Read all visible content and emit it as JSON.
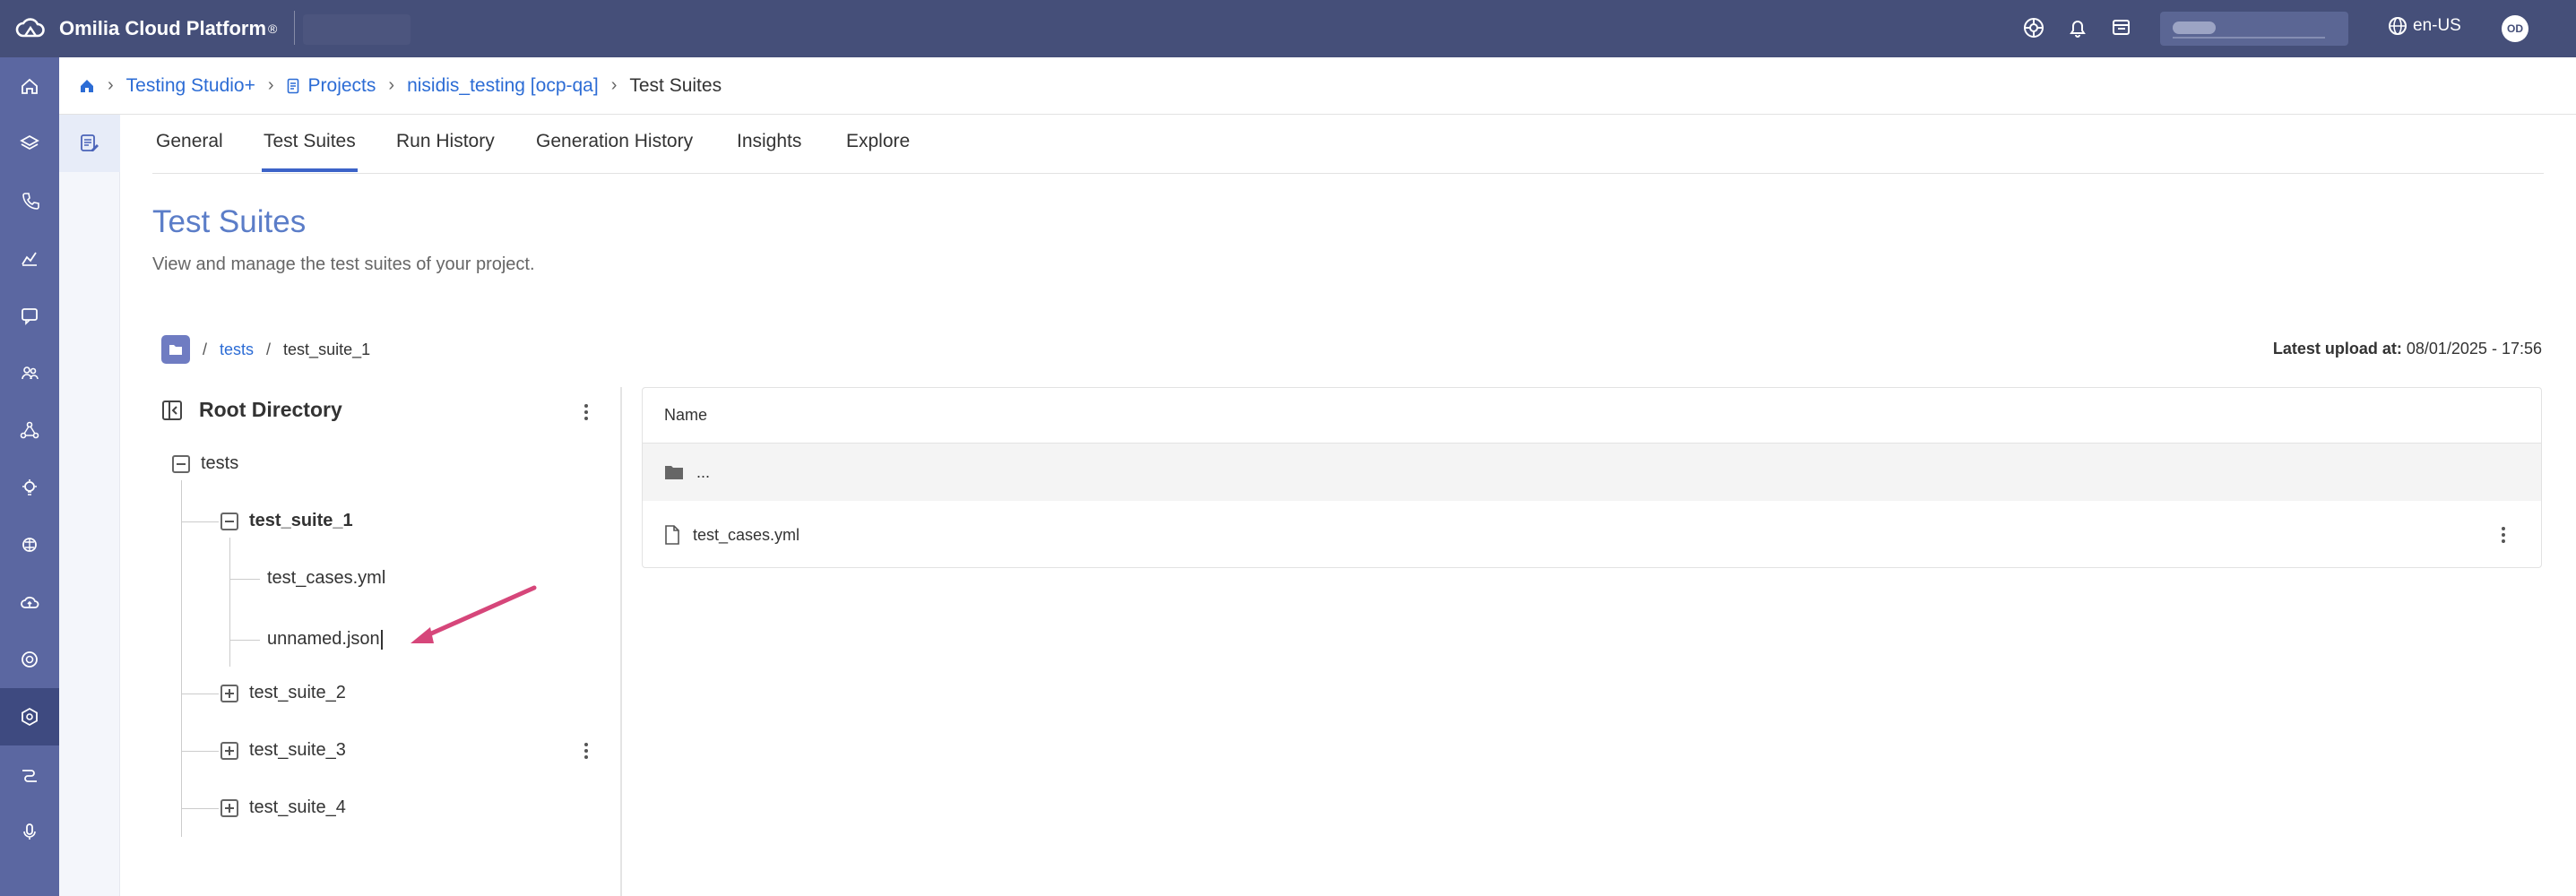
{
  "app": {
    "title": "Omilia Cloud Platform",
    "trademark": "®"
  },
  "topbar": {
    "icons": [
      "help-wheel-icon",
      "bell-icon",
      "notes-icon"
    ],
    "language": "en-US",
    "avatar_initials": "OD"
  },
  "leftnav": {
    "items": [
      "home-icon",
      "layers-icon",
      "phone-icon",
      "analytics-icon",
      "chat-icon",
      "users-icon",
      "network-icon",
      "bulb-icon",
      "brain-icon",
      "cloud-upload-icon",
      "support-icon",
      "settings-hex-icon",
      "flows-icon",
      "voice-icon"
    ],
    "active_index": 11
  },
  "breadcrumb": {
    "items": [
      "Testing Studio+",
      "Projects",
      "nisidis_testing [ocp-qa]"
    ],
    "current": "Test Suites"
  },
  "tabs": [
    "General",
    "Test Suites",
    "Run History",
    "Generation History",
    "Insights",
    "Explore"
  ],
  "active_tab": "Test Suites",
  "page": {
    "title": "Test Suites",
    "description": "View and manage the test suites of your project."
  },
  "path": {
    "sep": "/",
    "link": "tests",
    "current": "test_suite_1"
  },
  "upload": {
    "label": "Latest upload at:",
    "value": "08/01/2025 - 17:56"
  },
  "tree": {
    "header": "Root Directory",
    "root": "tests",
    "suites": [
      "test_suite_1",
      "test_suite_2",
      "test_suite_3",
      "test_suite_4"
    ],
    "expanded_files": [
      "test_cases.yml",
      "unnamed.json"
    ]
  },
  "table": {
    "header": "Name",
    "parent_row": "...",
    "files": [
      "test_cases.yml"
    ]
  },
  "colors": {
    "topbar": "#454f79",
    "nav": "#5b67a1",
    "link": "#2c6cd5",
    "title": "#5b7dc8",
    "annotation_arrow": "#d6467a"
  }
}
